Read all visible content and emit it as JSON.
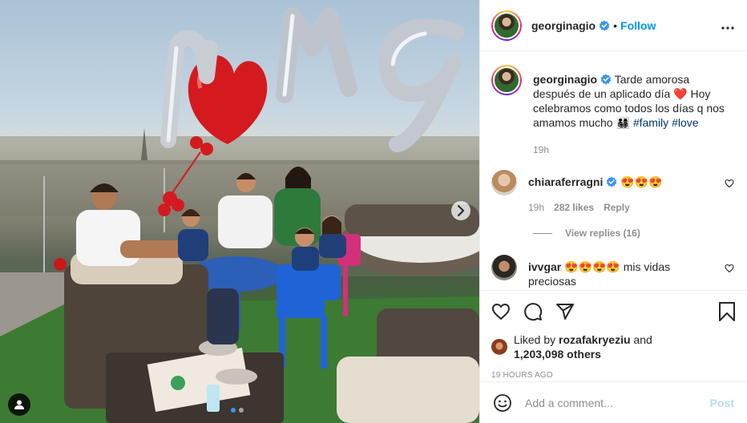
{
  "post": {
    "username": "georginagio",
    "follow_separator": "•",
    "follow_label": "Follow",
    "caption_text": "Tarde amorosa después de un aplicado día ❤️ Hoy celebramos como todos los días q nos amamos mucho 👨‍👩‍👧‍👦",
    "hashtags": [
      "#family",
      "#love"
    ],
    "caption_time": "19h",
    "balloon_letters": "MG"
  },
  "comments": [
    {
      "username": "chiaraferragni",
      "verified": true,
      "text": "😍😍😍",
      "time": "19h",
      "likes": "282 likes",
      "reply_label": "Reply",
      "view_replies": "View replies (16)"
    },
    {
      "username": "ivvgar",
      "verified": false,
      "text": "😍😍😍😍 mis vidas preciosas"
    }
  ],
  "likes": {
    "prefix": "Liked by",
    "user": "rozafakryeziu",
    "and": "and",
    "count": "1,203,098 others"
  },
  "timestamp": "19 HOURS AGO",
  "add_comment": {
    "placeholder": "Add a comment...",
    "post_label": "Post"
  },
  "colors": {
    "link": "#0095f6",
    "post_disabled": "#b2dffc",
    "heart": "#ed4956",
    "hashtag": "#00376b"
  },
  "icons": [
    "verified-badge-icon",
    "more-options-icon",
    "heart-icon",
    "comment-icon",
    "share-icon",
    "bookmark-icon",
    "emoji-icon",
    "chevron-right-icon",
    "user-tag-icon"
  ]
}
